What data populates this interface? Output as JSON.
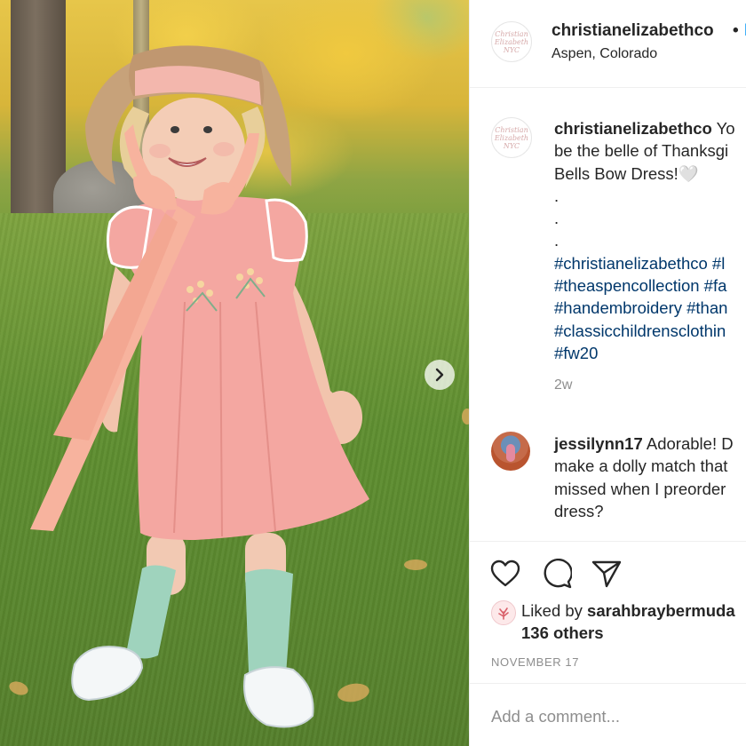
{
  "post": {
    "image_alt": "",
    "carousel_next_icon": "chevron-right-icon"
  },
  "header": {
    "username": "christianelizabethco",
    "separator": "•",
    "follow_label": "F",
    "location": "Aspen, Colorado",
    "avatar_logo_text": "Christian Elizabeth NYC"
  },
  "caption": {
    "username": "christianelizabethco",
    "line1_after_user": " Yo",
    "line2": "be the belle of Thanksgi",
    "line3": "Bells Bow Dress!🤍",
    "dots": [
      ".",
      ".",
      "."
    ],
    "hashtag_lines": [
      "#christianelizabethco #l",
      "#theaspencollection #fa",
      "#handembroidery #than",
      "#classicchildrensclothin",
      "#fw20"
    ],
    "time_ago": "2w"
  },
  "comment": {
    "username": "jessilynn17",
    "line1_after_user": " Adorable! D",
    "line2": "make a dolly match that",
    "line3": "missed when I preorder",
    "line4": "dress?"
  },
  "actions": {
    "icons": [
      "heart-icon",
      "comment-icon",
      "share-icon"
    ]
  },
  "likes": {
    "prefix": "Liked by ",
    "liker": "sarahbraybermuda",
    "others": "136 others"
  },
  "date": "NOVEMBER 17",
  "add_comment": {
    "placeholder": "Add a comment..."
  },
  "colors": {
    "link_blue": "#0095f6",
    "hashtag": "#00376b",
    "muted": "#8e8e8e",
    "dress_pink": "#f3a6a0",
    "socks_mint": "#9fd3bd"
  }
}
